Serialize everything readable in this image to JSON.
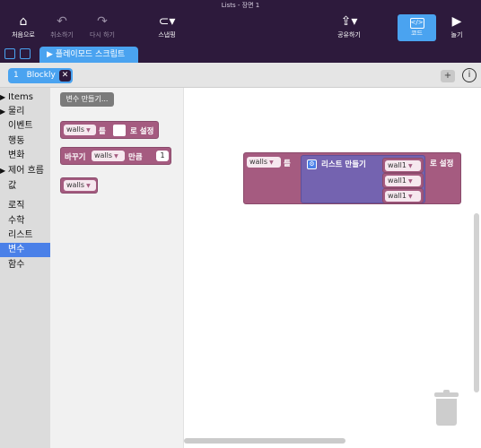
{
  "window": {
    "title": "Lists - 장면 1"
  },
  "toolbar": {
    "home": "처음으로",
    "undo": "취소하기",
    "redo": "다시 하기",
    "snap": "스냅핑",
    "share": "공유하기",
    "code": "코드",
    "play": "놀기"
  },
  "tabs": {
    "script_tab": "플레이모드 스크립트"
  },
  "subtabs": {
    "number": "1",
    "label": "Blockly",
    "close": "✕"
  },
  "actions": {
    "add": "+",
    "info": "i"
  },
  "toolbox": {
    "categories": [
      {
        "label": "Items",
        "arrow": true
      },
      {
        "label": "물리",
        "arrow": true
      },
      {
        "label": "이벤트",
        "arrow": false
      },
      {
        "label": "행동",
        "arrow": false
      },
      {
        "label": "변화",
        "arrow": false
      },
      {
        "label": "제어 흐름",
        "arrow": true
      },
      {
        "label": "값",
        "arrow": false
      },
      {
        "label": "로직",
        "arrow": false
      },
      {
        "label": "수학",
        "arrow": false
      },
      {
        "label": "리스트",
        "arrow": false
      },
      {
        "label": "변수",
        "arrow": false,
        "selected": true
      },
      {
        "label": "함수",
        "arrow": false
      }
    ]
  },
  "flyout": {
    "make_var": "변수 만들기...",
    "set_block": {
      "var": "walls",
      "particle": "를",
      "suffix": "로 설정"
    },
    "change_block": {
      "prefix": "바꾸기",
      "var": "walls",
      "mid": "만큼",
      "value": "1"
    },
    "get_block": {
      "var": "walls"
    }
  },
  "workspace": {
    "set_block": {
      "var": "walls",
      "particle": "를",
      "suffix": "로 설정",
      "list_label": "리스트 만들기",
      "items": [
        "wall1",
        "wall1",
        "wall1"
      ]
    }
  },
  "colors": {
    "accent": "#4aa3f0",
    "variable_block": "#a55b80",
    "list_block": "#7463b0",
    "dark": "#2d1a3c"
  }
}
